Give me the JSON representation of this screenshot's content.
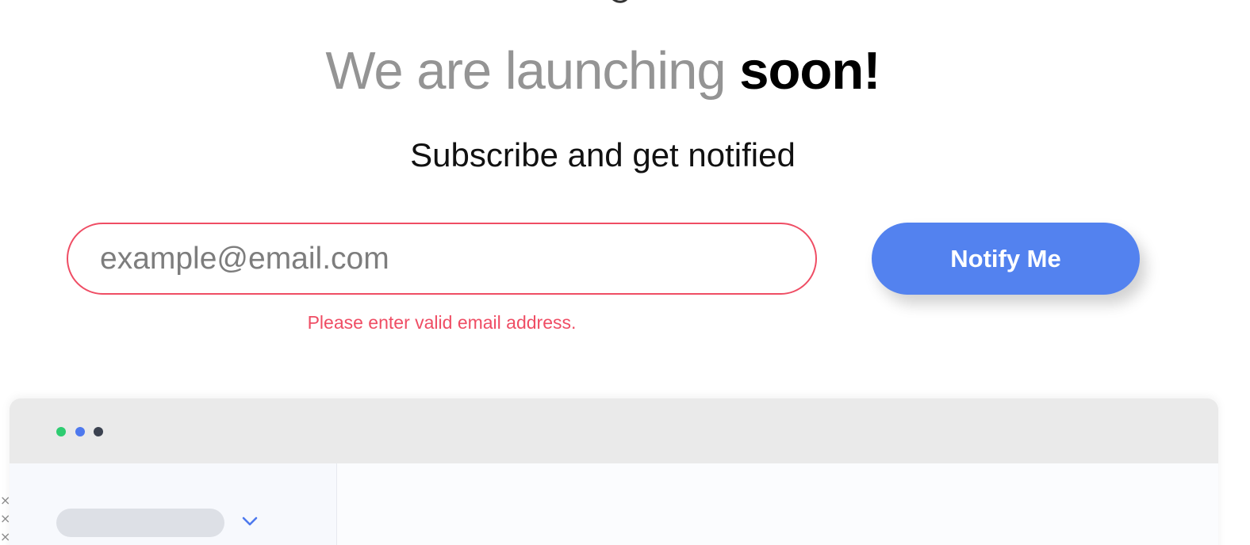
{
  "hero": {
    "headline_light": "We are launching",
    "headline_bold": "soon!",
    "subtitle": "Subscribe and get notified"
  },
  "form": {
    "email_placeholder": "example@email.com",
    "email_value": "",
    "error_message": "Please enter valid email address.",
    "submit_label": "Notify Me"
  },
  "mockup": {
    "window_dots": [
      "green",
      "blue",
      "dark"
    ],
    "sidebar_dropdown_icon": "chevron-down-icon"
  },
  "side_marks": [
    "×",
    "×",
    "×"
  ],
  "colors": {
    "accent": "#5382ef",
    "error": "#ef4d64",
    "headline_gray": "#949494",
    "dot_green": "#2ecc71",
    "dot_blue": "#4e79ee",
    "dot_dark": "#3b4250"
  }
}
